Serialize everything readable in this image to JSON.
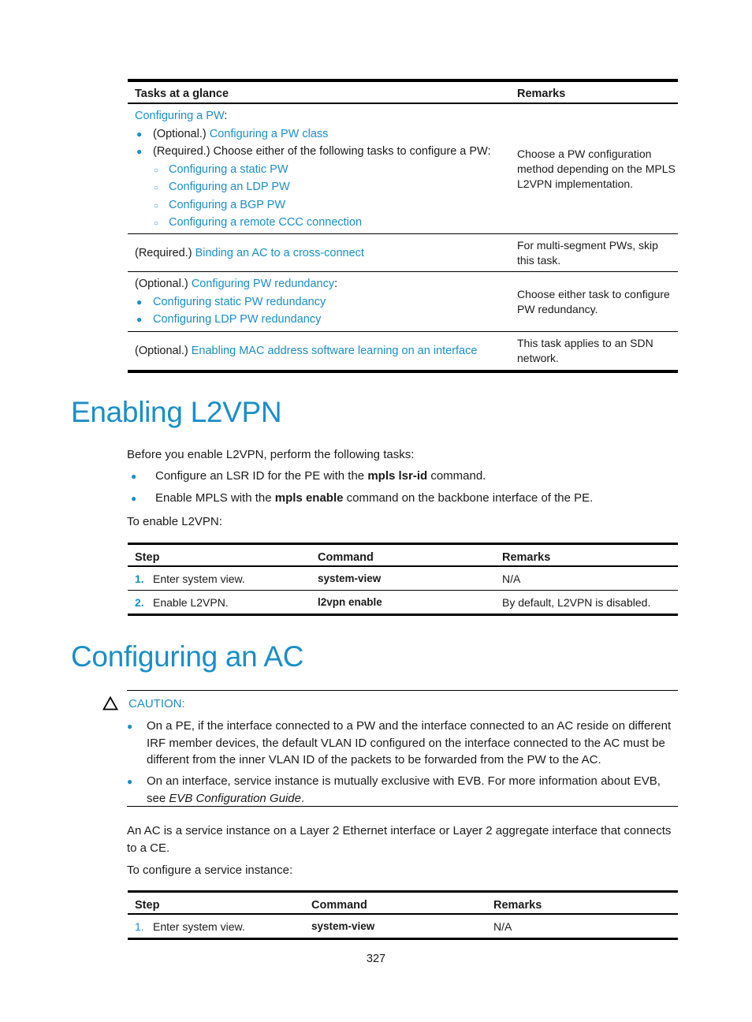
{
  "tasks_table": {
    "headers": [
      "Tasks at a glance",
      "Remarks"
    ],
    "rows": [
      {
        "lines": [
          {
            "type": "plain-link",
            "link": "Configuring a PW",
            "suffix": ":"
          },
          {
            "type": "bullet",
            "prefix": "(Optional.) ",
            "link": "Configuring a PW class"
          },
          {
            "type": "bullet",
            "prefix": "(Required.) Choose either of the following tasks to configure a PW:",
            "link": ""
          },
          {
            "type": "sub",
            "link": "Configuring a static PW"
          },
          {
            "type": "sub",
            "link": "Configuring an LDP PW"
          },
          {
            "type": "sub",
            "link": "Configuring a BGP PW"
          },
          {
            "type": "sub",
            "link": "Configuring a remote CCC connection"
          }
        ],
        "remark": "Choose a PW configuration method depending on the MPLS L2VPN implementation."
      },
      {
        "prefix": "(Required.) ",
        "link": "Binding an AC to a cross-connect",
        "remark": "For multi-segment PWs, skip this task."
      },
      {
        "prefix": "(Optional.) ",
        "link": "Configuring PW redundancy",
        "suffix": ":",
        "bullets": [
          "Configuring static PW redundancy",
          "Configuring LDP PW redundancy"
        ],
        "remark": "Choose either task to configure PW redundancy."
      },
      {
        "prefix": "(Optional.) ",
        "link": "Enabling MAC address software learning on an interface",
        "remark": "This task applies to an SDN network."
      }
    ]
  },
  "section_enable": {
    "title": "Enabling L2VPN",
    "intro": "Before you enable L2VPN, perform the following tasks:",
    "bullets": [
      {
        "pre": "Configure an LSR ID for the PE with the ",
        "bold": "mpls lsr-id",
        "post": " command."
      },
      {
        "pre": "Enable MPLS with the ",
        "bold": "mpls enable",
        "post": " command on the backbone interface of the PE."
      }
    ],
    "lead": "To enable L2VPN:",
    "table": {
      "headers": [
        "Step",
        "Command",
        "Remarks"
      ],
      "rows": [
        {
          "num": "1.",
          "step": "Enter system view.",
          "command": "system-view",
          "remark": "N/A"
        },
        {
          "num": "2.",
          "step": "Enable L2VPN.",
          "command": "l2vpn enable",
          "remark": "By default, L2VPN is disabled."
        }
      ]
    }
  },
  "section_ac": {
    "title": "Configuring an AC",
    "caution": {
      "label": "CAUTION:",
      "items": [
        {
          "text": "On a PE, if the interface connected to a PW and the interface connected to an AC reside on different IRF member devices, the default VLAN ID configured on the interface connected to the AC must be different from the inner VLAN ID of the packets to be forwarded from the PW to the AC.",
          "italic": "",
          "post": ""
        },
        {
          "text": "On an interface, service instance is mutually exclusive with EVB. For more information about EVB, see ",
          "italic": "EVB Configuration Guide",
          "post": "."
        }
      ]
    },
    "para1": "An AC is a service instance on a Layer 2 Ethernet interface or Layer 2 aggregate interface that connects to a CE.",
    "lead": "To configure a service instance:",
    "table": {
      "headers": [
        "Step",
        "Command",
        "Remarks"
      ],
      "rows": [
        {
          "num": "1.",
          "step": "Enter system view.",
          "command": "system-view",
          "remark": "N/A"
        }
      ]
    }
  },
  "page_number": "327"
}
